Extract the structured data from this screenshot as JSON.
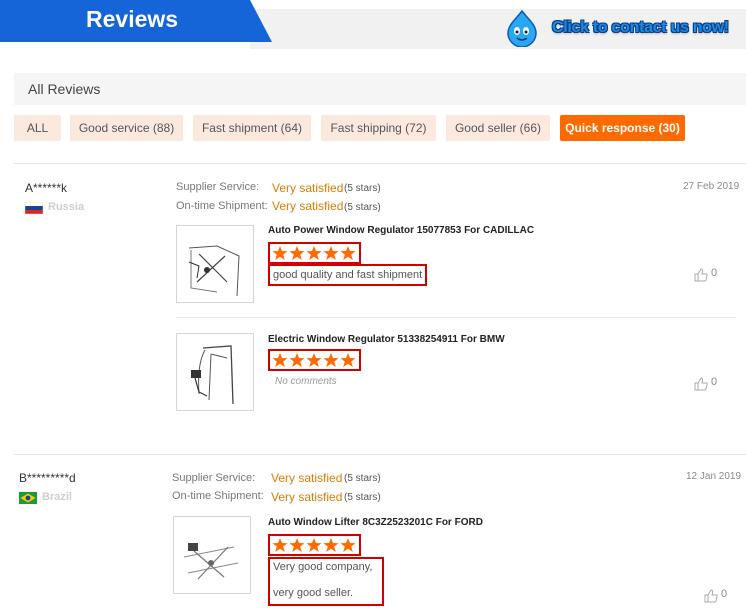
{
  "header": {
    "title": "Reviews",
    "contact": "Click to contact us now!"
  },
  "all_reviews": {
    "label": "All Reviews"
  },
  "filters": [
    {
      "label": "ALL"
    },
    {
      "label": "Good service (88)"
    },
    {
      "label": "Fast shipment (64)"
    },
    {
      "label": "Fast shipping (72)"
    },
    {
      "label": "Good seller (66)"
    },
    {
      "label": "Quick response (30)"
    }
  ],
  "labels": {
    "supplier_service": "Supplier Service:",
    "ontime_shipment": "On-time Shipment:"
  },
  "reviews": [
    {
      "name": "A******k",
      "country": "Russia",
      "date": "27  Feb 2019",
      "supplier_value": "Very satisfied",
      "supplier_stars": "(5 stars)",
      "shipment_value": "Very satisfied",
      "shipment_stars": "(5 stars)",
      "items": [
        {
          "product": "Auto Power Window Regulator 15077853 For CADILLAC",
          "rating": 5,
          "comment": "good quality and fast shipment",
          "likes": "0"
        },
        {
          "product": "Electric Window Regulator 51338254911 For BMW",
          "rating": 5,
          "comment": "No comments",
          "likes": "0"
        }
      ]
    },
    {
      "name": "B*********d",
      "country": "Brazil",
      "date": "12 Jan 2019",
      "supplier_value": "Very satisfied",
      "supplier_stars": "(5 stars)",
      "shipment_value": "Very satisfied",
      "shipment_stars": "(5 stars)",
      "items": [
        {
          "product": "Auto Window Lifter 8C3Z2523201C For FORD",
          "rating": 5,
          "comment_line1": "Very good company,",
          "comment_line2": "very good seller.",
          "likes": "0"
        }
      ]
    }
  ],
  "colors": {
    "accent": "#ff6a00",
    "header_blue": "#1565d8",
    "highlight_box": "#d40000",
    "satisfied": "#e07b00"
  }
}
